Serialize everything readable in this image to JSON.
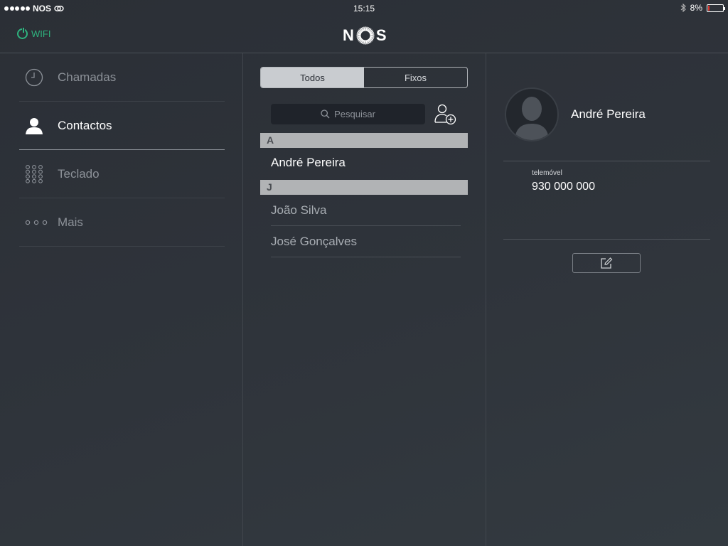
{
  "status_bar": {
    "carrier": "NOS",
    "time": "15:15",
    "battery": "8%",
    "battery_level": 0.08
  },
  "header": {
    "wifi_label": "WIFI",
    "logo_left": "N",
    "logo_right": "S"
  },
  "sidebar": {
    "items": [
      {
        "label": "Chamadas",
        "icon": "clock-icon"
      },
      {
        "label": "Contactos",
        "icon": "person-icon"
      },
      {
        "label": "Teclado",
        "icon": "keypad-icon"
      },
      {
        "label": "Mais",
        "icon": "more-icon"
      }
    ]
  },
  "contacts": {
    "tabs": [
      "Todos",
      "Fixos"
    ],
    "search_placeholder": "Pesquisar",
    "sections": [
      {
        "letter": "A",
        "items": [
          "André Pereira"
        ]
      },
      {
        "letter": "J",
        "items": [
          "João Silva",
          "José Gonçalves"
        ]
      }
    ]
  },
  "detail": {
    "name": "André Pereira",
    "phone_label": "telemóvel",
    "phone_number": "930 000 000"
  },
  "colors": {
    "accent_green": "#2eb37e",
    "background": "#2b2f36"
  }
}
